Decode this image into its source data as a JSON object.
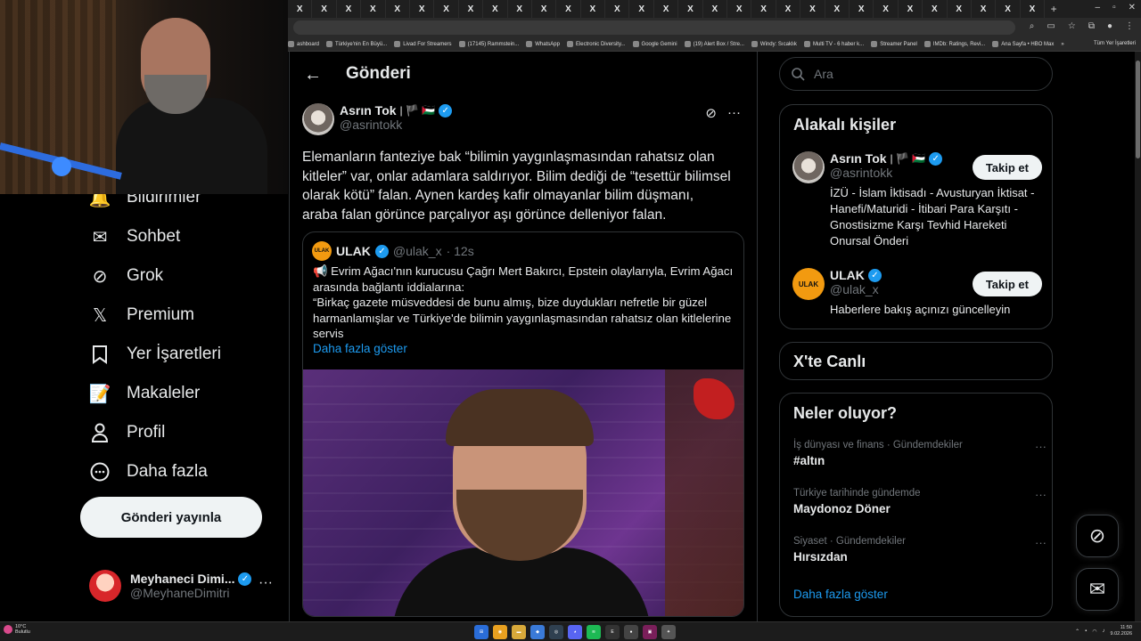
{
  "browser": {
    "tab_label": "X",
    "tab_count": 31,
    "new_tab": "+",
    "bookmarks": [
      "ashboard",
      "Türkiye'nin En Büyü...",
      "Livad For Streamers",
      "(17145) Rammstein...",
      "WhatsApp",
      "Electronic Diversity...",
      "Google Gemini",
      "(19) Alert Box / Stre...",
      "Windy: Sıcaklık",
      "Multi TV - 6 haber k...",
      "Streamer Panel",
      "IMDb: Ratings, Revi...",
      "Ana Sayfa • HBO Max"
    ],
    "bookmarks_more": "»",
    "all_bookmarks": "Tüm Yer İşaretleri"
  },
  "sidebar": {
    "items": [
      {
        "label": "Bildirimler",
        "icon": "bell-icon"
      },
      {
        "label": "Sohbet",
        "icon": "mail-icon"
      },
      {
        "label": "Grok",
        "icon": "grok-icon"
      },
      {
        "label": "Premium",
        "icon": "x-logo-icon"
      },
      {
        "label": "Yer İşaretleri",
        "icon": "bookmark-icon"
      },
      {
        "label": "Makaleler",
        "icon": "article-icon"
      },
      {
        "label": "Profil",
        "icon": "person-icon"
      },
      {
        "label": "Daha fazla",
        "icon": "more-circle-icon"
      }
    ],
    "post_button": "Gönderi yayınla",
    "account": {
      "name": "Meyhaneci Dimi...",
      "handle": "@MeyhaneDimitri",
      "more": "···"
    }
  },
  "main": {
    "title": "Gönderi",
    "tweet": {
      "name": "Asrın Tok",
      "flags": "| 🏴 🇵🇸",
      "handle": "@asrintokk",
      "text": "Elemanların fanteziye bak “bilimin yaygınlaşmasından rahatsız olan kitleler” var, onlar adamlara saldırıyor. Bilim dediği de “tesettür bilimsel olarak kötü” falan. Aynen kardeş kafir olmayanlar bilim düşmanı, araba falan görünce parçalıyor aşı görünce delleniyor falan.",
      "more": "···"
    },
    "quote": {
      "avatar_text": "ULAK",
      "name": "ULAK",
      "handle": "@ulak_x",
      "time": "· 12s",
      "text_line1": "📢 Evrim Ağacı'nın kurucusu Çağrı Mert Bakırcı, Epstein olaylarıyla, Evrim Ağacı arasında bağlantı iddialarına:",
      "text_line2": "“Birkaç gazete müsveddesi de bunu almış, bize duydukları nefretle bir güzel harmanlamışlar ve Türkiye'de bilimin yaygınlaşmasından rahatsız olan kitlelerine servis",
      "show_more": "Daha fazla göster"
    }
  },
  "right": {
    "search_placeholder": "Ara",
    "related": {
      "title": "Alakalı kişiler",
      "people": [
        {
          "name": "Asrın Tok",
          "flags": "| 🏴 🇵🇸",
          "handle": "@asrintokk",
          "bio": "İZÜ - İslam İktisadı - Avusturyan İktisat - Hanefi/Maturidi - İtibari Para Karşıtı - Gnostisizme Karşı Tevhid Hareketi Onursal Önderi",
          "follow": "Takip et"
        },
        {
          "name": "ULAK",
          "handle": "@ulak_x",
          "bio": "Haberlere bakış açınızı güncelleyin",
          "follow": "Takip et"
        }
      ]
    },
    "live": {
      "title": "X'te Canlı"
    },
    "trends": {
      "title": "Neler oluyor?",
      "items": [
        {
          "meta": "İş dünyası ve finans · Gündemdekiler",
          "topic": "#altın"
        },
        {
          "meta": "Türkiye tarihinde gündemde",
          "topic": "Maydonoz Döner"
        },
        {
          "meta": "Siyaset · Gündemdekiler",
          "topic": "Hırsızdan"
        }
      ],
      "show_more": "Daha fazla göster"
    }
  },
  "taskbar": {
    "weather_temp": "10°C",
    "weather_desc": "Bulutlu",
    "time": "11:50",
    "date": "9.02.2026"
  },
  "colors": {
    "accent": "#1d9bf0",
    "background": "#000000",
    "border": "#2f3336",
    "muted": "#71767b"
  }
}
